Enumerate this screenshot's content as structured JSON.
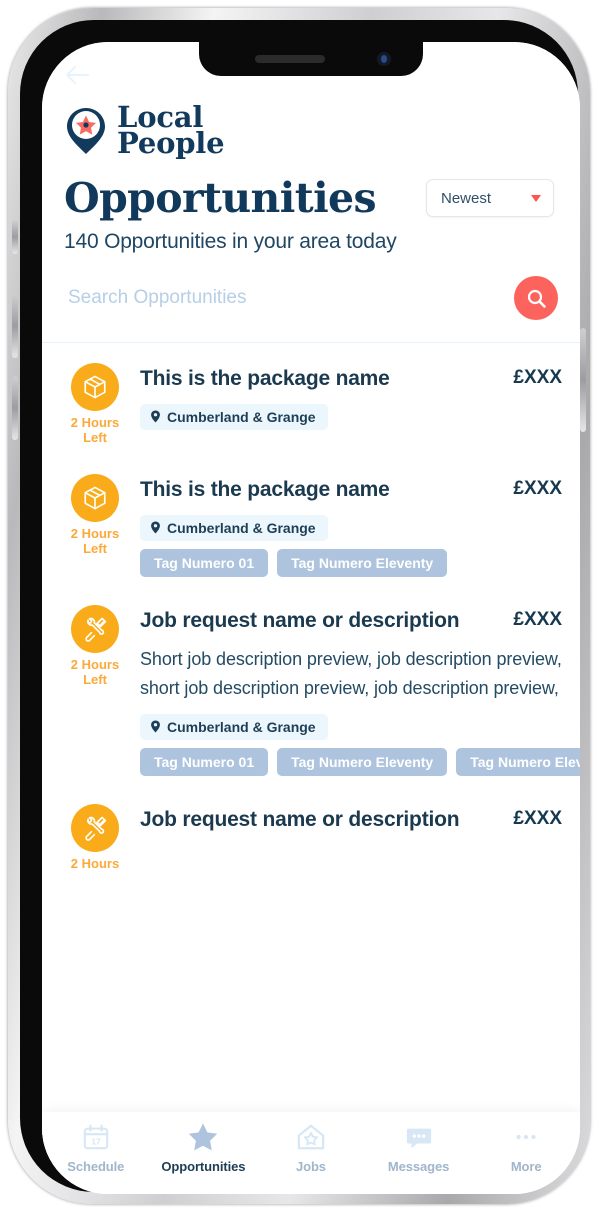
{
  "brand": {
    "logo_line1": "Local",
    "logo_line2": "People",
    "logo_icon": "map-pin-star-logo",
    "pin_color": "#123a5c",
    "star_color": "#fb6a62"
  },
  "nav": {
    "back_icon": "back-arrow-icon"
  },
  "header": {
    "title": "Opportunities",
    "subtitle": "140 Opportunities in your area today",
    "sort": {
      "value": "Newest",
      "caret_icon": "chevron-down-icon",
      "caret_color": "#f8584f"
    }
  },
  "search": {
    "placeholder": "Search Opportunities",
    "value": "",
    "button_icon": "search-icon",
    "button_color": "#fb635c"
  },
  "list": {
    "items": [
      {
        "icon": "package-box-icon",
        "icon_bg": "#faab19",
        "time_left": "2 Hours\nLeft",
        "title": "This is the package name",
        "price": "£XXX",
        "description": "",
        "location": "Cumberland & Grange",
        "location_icon": "map-pin-icon",
        "tags": []
      },
      {
        "icon": "package-box-icon",
        "icon_bg": "#faab19",
        "time_left": "2 Hours\nLeft",
        "title": "This is the package name",
        "price": "£XXX",
        "description": "",
        "location": "Cumberland & Grange",
        "location_icon": "map-pin-icon",
        "tags": [
          "Tag Numero 01",
          "Tag Numero  Eleventy"
        ]
      },
      {
        "icon": "tools-icon",
        "icon_bg": "#faab19",
        "time_left": "2 Hours\nLeft",
        "title": "Job request name or description",
        "price": "£XXX",
        "description": "Short job description preview, job description preview, short job description preview, job description preview,",
        "location": "Cumberland & Grange",
        "location_icon": "map-pin-icon",
        "tags": [
          "Tag Numero 01",
          "Tag Numero  Eleventy",
          "Tag Numero  Eleventy"
        ]
      },
      {
        "icon": "tools-icon",
        "icon_bg": "#faab19",
        "time_left": "2 Hours",
        "title": "Job request name or description",
        "price": "£XXX",
        "description": "",
        "location": "",
        "location_icon": "map-pin-icon",
        "tags": []
      }
    ]
  },
  "tabbar": {
    "items": [
      {
        "label": "Schedule",
        "icon": "calendar-icon",
        "active": false
      },
      {
        "label": "Opportunities",
        "icon": "star-icon",
        "active": true
      },
      {
        "label": "Jobs",
        "icon": "house-star-icon",
        "active": false
      },
      {
        "label": "Messages",
        "icon": "chat-bubble-icon",
        "active": false
      },
      {
        "label": "More",
        "icon": "ellipsis-icon",
        "active": false
      }
    ],
    "calendar_day": "17"
  }
}
